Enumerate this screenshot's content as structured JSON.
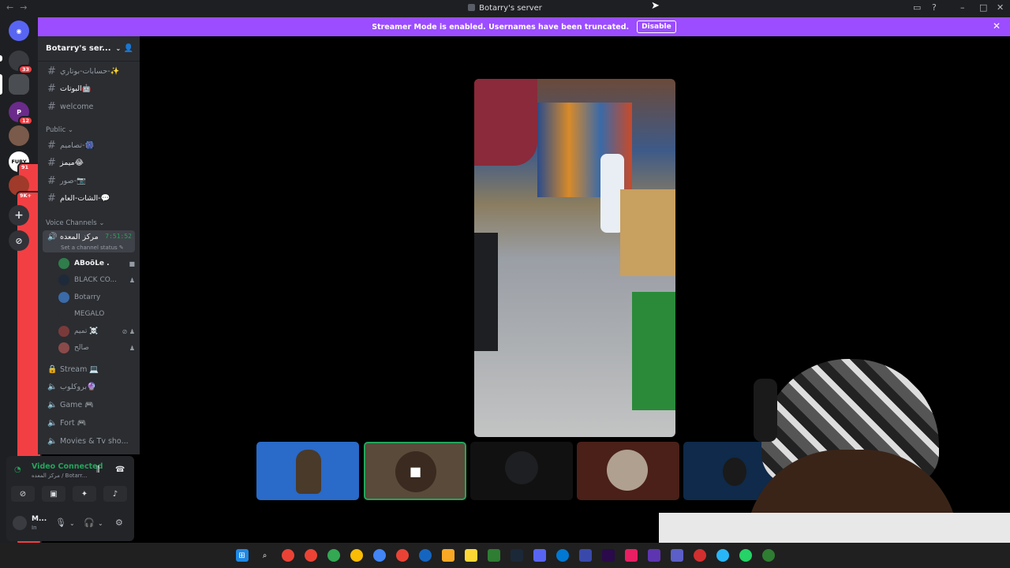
{
  "window": {
    "title": "Botarry's server"
  },
  "banner": {
    "text": "Streamer Mode is enabled. Usernames have been truncated.",
    "action": "Disable"
  },
  "servers": [
    {
      "id": "home",
      "badge": ""
    },
    {
      "id": "s1",
      "badge": "33"
    },
    {
      "id": "s2",
      "badge": ""
    },
    {
      "id": "s3",
      "badge": "12"
    },
    {
      "id": "s4",
      "badge": ""
    },
    {
      "id": "s5",
      "label": "FURY",
      "badge": "91"
    },
    {
      "id": "s6",
      "badge": "9K+"
    }
  ],
  "server": {
    "name": "Botarry's ser..."
  },
  "channels": {
    "top": [
      {
        "name": "حسابات-بوتاري-✨"
      },
      {
        "name": "البوتات🤖"
      },
      {
        "name": "welcome"
      }
    ],
    "public_label": "Public",
    "public": [
      {
        "name": "تصاميم-🎆"
      },
      {
        "name": "ميمز😂"
      },
      {
        "name": "صور-📷"
      },
      {
        "name": "الشات-العام-💬"
      }
    ],
    "voice_label": "Voice Channels",
    "voice_active": {
      "name": "مركز المعده",
      "timer": "7:51:52",
      "status": "Set a channel status"
    },
    "voice_users": [
      {
        "name": "ABoöLe ."
      },
      {
        "name": "BLACK CO..."
      },
      {
        "name": "Botarry"
      },
      {
        "name": "MEGALO"
      },
      {
        "name": "تميم ☠️"
      },
      {
        "name": "صالح"
      }
    ],
    "voice_other": [
      {
        "name": "Stream 💻"
      },
      {
        "name": "بروكلوب🔮"
      },
      {
        "name": "Game 🎮"
      },
      {
        "name": "Fort 🎮"
      },
      {
        "name": "Movies & Tv sho..."
      }
    ]
  },
  "panel": {
    "connection": "Video Connected",
    "channel": "مركز المعده / Botarr...",
    "user": "M...",
    "status": "In"
  },
  "colors": {
    "accent": "#9b4dff",
    "sidebar": "#2b2d31",
    "rail": "#1e1f22",
    "green": "#23a55a"
  }
}
